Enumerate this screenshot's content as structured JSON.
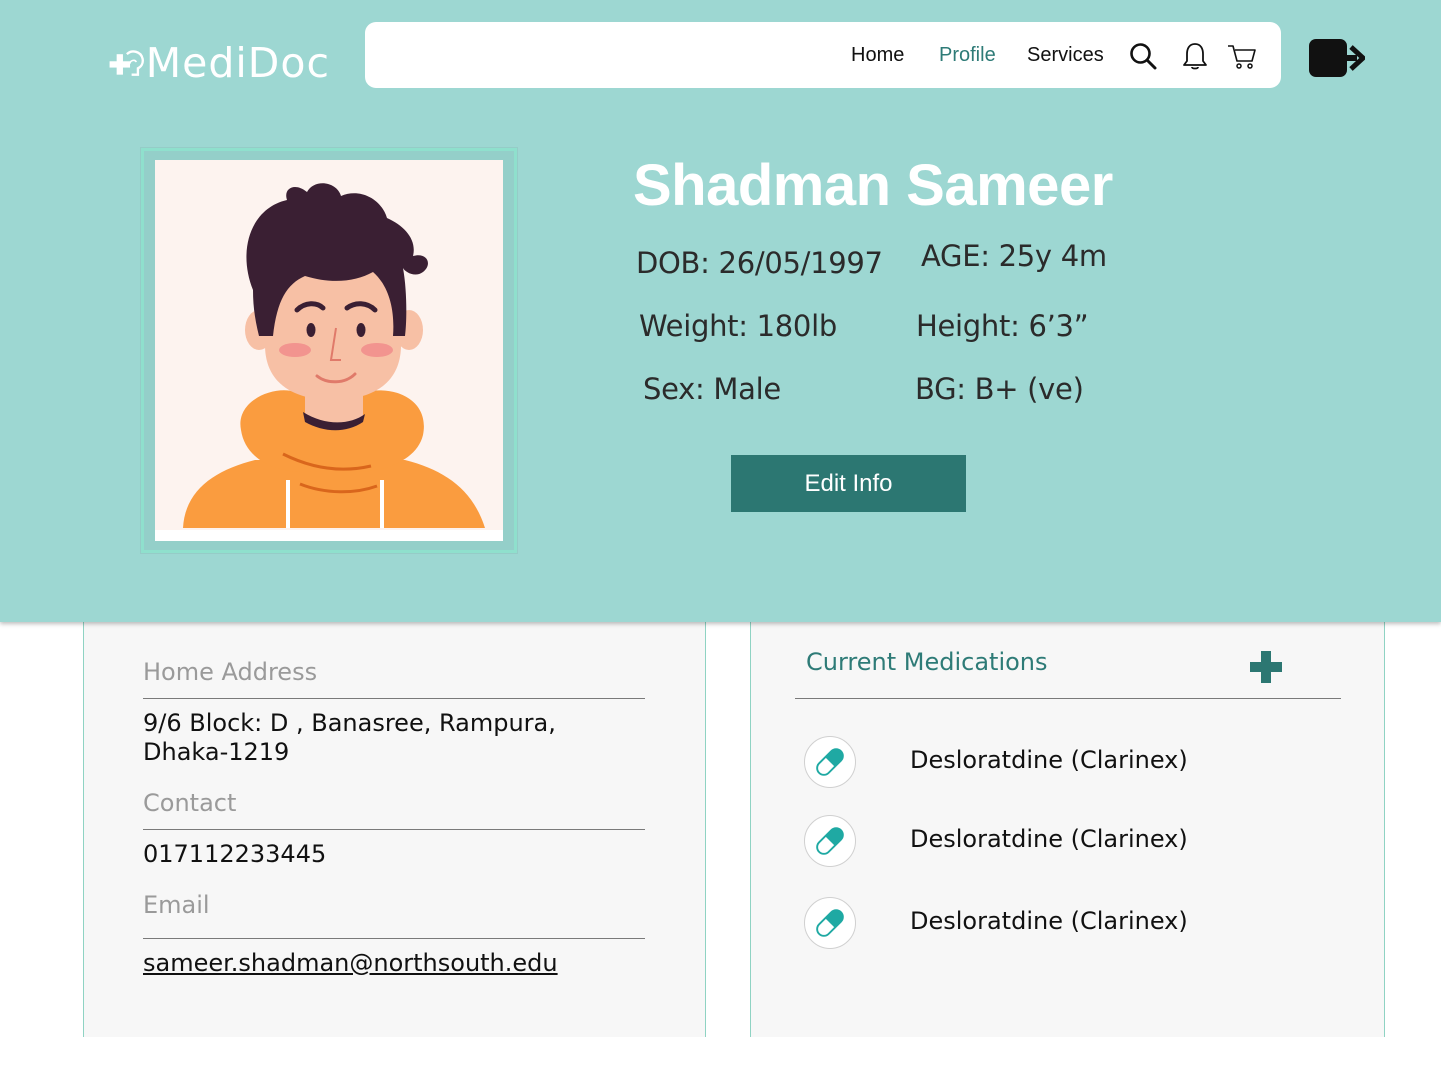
{
  "app": {
    "logo_text": "MediDoc"
  },
  "nav": {
    "home": "Home",
    "profile": "Profile",
    "services": "Services"
  },
  "profile": {
    "name": "Shadman Sameer",
    "dob": "DOB: 26/05/1997",
    "age": "AGE: 25y 4m",
    "weight": "Weight: 180lb",
    "height": "Height: 6’3”",
    "sex": "Sex: Male",
    "blood_group": "BG: B+ (ve)",
    "edit_label": "Edit Info"
  },
  "contact_card": {
    "address_label": "Home Address",
    "address_line1": "9/6 Block: D , Banasree, Rampura,",
    "address_line2": "Dhaka-1219",
    "contact_label": "Contact",
    "contact_value": "017112233445",
    "email_label": "Email",
    "email_value": "sameer.shadman@northsouth.edu"
  },
  "medications": {
    "title": "Current Medications",
    "items": [
      {
        "name": "Desloratdine (Clarinex)"
      },
      {
        "name": "Desloratdine (Clarinex)"
      },
      {
        "name": "Desloratdine (Clarinex)"
      }
    ]
  },
  "colors": {
    "hero_bg": "#9dd7d2",
    "accent": "#2c7772",
    "active_nav": "#2e7b77",
    "card_bg": "#f7f7f7"
  },
  "icons": [
    "logo-icon",
    "search-icon",
    "bell-icon",
    "cart-icon",
    "logout-icon",
    "plus-icon",
    "pill-icon",
    "avatar"
  ]
}
